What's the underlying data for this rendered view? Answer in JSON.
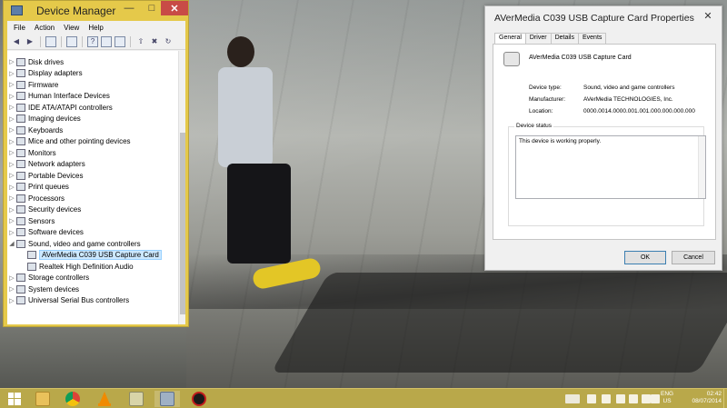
{
  "device_manager": {
    "title": "Device Manager",
    "menu": [
      "File",
      "Action",
      "View",
      "Help"
    ],
    "tree": [
      {
        "label": "Disk drives",
        "expanded": false,
        "level": 0
      },
      {
        "label": "Display adapters",
        "expanded": false,
        "level": 0
      },
      {
        "label": "Firmware",
        "expanded": false,
        "level": 0
      },
      {
        "label": "Human Interface Devices",
        "expanded": false,
        "level": 0
      },
      {
        "label": "IDE ATA/ATAPI controllers",
        "expanded": false,
        "level": 0
      },
      {
        "label": "Imaging devices",
        "expanded": false,
        "level": 0
      },
      {
        "label": "Keyboards",
        "expanded": false,
        "level": 0
      },
      {
        "label": "Mice and other pointing devices",
        "expanded": false,
        "level": 0
      },
      {
        "label": "Monitors",
        "expanded": false,
        "level": 0
      },
      {
        "label": "Network adapters",
        "expanded": false,
        "level": 0
      },
      {
        "label": "Portable Devices",
        "expanded": false,
        "level": 0
      },
      {
        "label": "Print queues",
        "expanded": false,
        "level": 0
      },
      {
        "label": "Processors",
        "expanded": false,
        "level": 0
      },
      {
        "label": "Security devices",
        "expanded": false,
        "level": 0
      },
      {
        "label": "Sensors",
        "expanded": false,
        "level": 0
      },
      {
        "label": "Software devices",
        "expanded": false,
        "level": 0
      },
      {
        "label": "Sound, video and game controllers",
        "expanded": true,
        "level": 0
      },
      {
        "label": "AVerMedia C039 USB Capture Card",
        "expanded": false,
        "level": 1,
        "selected": true
      },
      {
        "label": "Realtek High Definition Audio",
        "expanded": false,
        "level": 1
      },
      {
        "label": "Storage controllers",
        "expanded": false,
        "level": 0
      },
      {
        "label": "System devices",
        "expanded": false,
        "level": 0
      },
      {
        "label": "Universal Serial Bus controllers",
        "expanded": false,
        "level": 0
      }
    ]
  },
  "properties": {
    "title": "AVerMedia C039 USB Capture Card Properties",
    "tabs": [
      "General",
      "Driver",
      "Details",
      "Events"
    ],
    "active_tab": "General",
    "device_name": "AVerMedia C039 USB Capture Card",
    "device_type_label": "Device type:",
    "device_type": "Sound, video and game controllers",
    "manufacturer_label": "Manufacturer:",
    "manufacturer": "AVerMedia TECHNOLOGIES, Inc.",
    "location_label": "Location:",
    "location": "0000.0014.0000.001.001.000.000.000.000",
    "status_group": "Device status",
    "status_text": "This device is working properly.",
    "ok_label": "OK",
    "cancel_label": "Cancel"
  },
  "taskbar": {
    "language": "ENG",
    "region": "US",
    "time": "02:42",
    "date": "08/07/2014",
    "pinned": [
      "start-icon",
      "file-explorer-icon",
      "chrome-icon",
      "vlc-icon",
      "folder-icon",
      "device-manager-icon",
      "game-icon"
    ]
  },
  "colors": {
    "accent": "#e5c94a",
    "taskbar": "#b9a84a",
    "close": "#c84b46"
  }
}
